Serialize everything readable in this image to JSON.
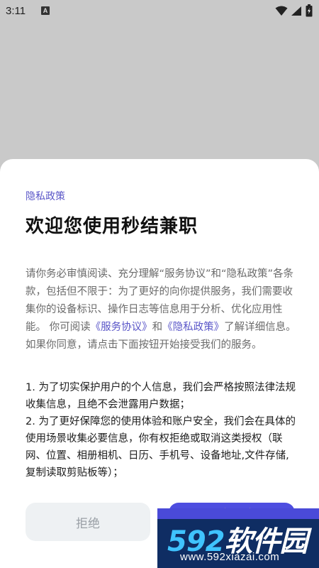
{
  "status_bar": {
    "time": "3:11",
    "notification_badge": "A",
    "icons": [
      "wifi-icon",
      "signal-icon",
      "battery-icon"
    ]
  },
  "dialog": {
    "subtitle": "隐私政策",
    "title": "欢迎您使用秒结兼职",
    "intro": {
      "part1": "请你务必审慎阅读、充分理解“服务协议”和“隐私政策”各条款，包括但不限于：为了更好的向你提供服务，我们需要收集你的设备标识、操作日志等信息用于分析、优化应用性能。 你可阅读",
      "link1": "《服务协议》",
      "part2": "和",
      "link2": "《隐私政策》",
      "part3": "了解详细信息。如果你同意，请点击下面按钮开始接受我们的服务。"
    },
    "rules": [
      "1. 为了切实保护用户的个人信息，我们会严格按照法律法规收集信息，且绝不会泄露用户数据；",
      "2. 为了更好保障您的使用体验和账户安全，我们会在具体的使用场景收集必要信息，你有权拒绝或取消这类授权（联网、位置、相册相机、日历、手机号、设备地址,文件存储,复制读取剪贴板等）；"
    ],
    "reject_label": "拒绝"
  },
  "watermark": {
    "logo_number": "592",
    "logo_text": "软件园",
    "url": "www.592xiazai.com"
  },
  "colors": {
    "accent": "#5a56c8",
    "button_primary": "#4e4ee0",
    "button_secondary": "#eef1f3",
    "overlay": "#c9c9c9"
  }
}
